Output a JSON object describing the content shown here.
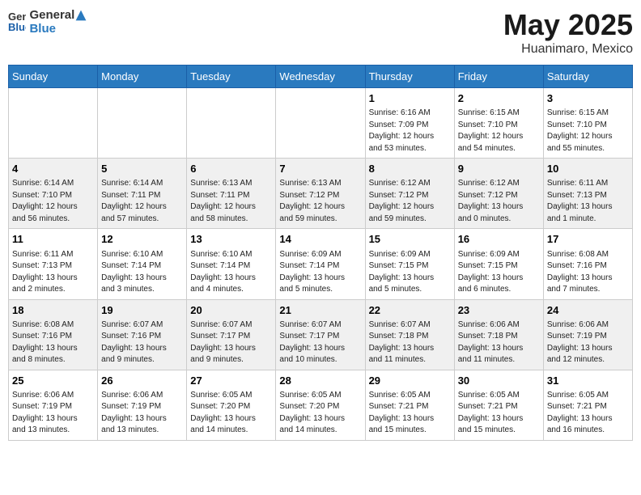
{
  "header": {
    "logo_line1": "General",
    "logo_line2": "Blue",
    "title": "May 2025",
    "subtitle": "Huanimaro, Mexico"
  },
  "days_of_week": [
    "Sunday",
    "Monday",
    "Tuesday",
    "Wednesday",
    "Thursday",
    "Friday",
    "Saturday"
  ],
  "weeks": [
    [
      {
        "day": "",
        "info": ""
      },
      {
        "day": "",
        "info": ""
      },
      {
        "day": "",
        "info": ""
      },
      {
        "day": "",
        "info": ""
      },
      {
        "day": "1",
        "info": "Sunrise: 6:16 AM\nSunset: 7:09 PM\nDaylight: 12 hours\nand 53 minutes."
      },
      {
        "day": "2",
        "info": "Sunrise: 6:15 AM\nSunset: 7:10 PM\nDaylight: 12 hours\nand 54 minutes."
      },
      {
        "day": "3",
        "info": "Sunrise: 6:15 AM\nSunset: 7:10 PM\nDaylight: 12 hours\nand 55 minutes."
      }
    ],
    [
      {
        "day": "4",
        "info": "Sunrise: 6:14 AM\nSunset: 7:10 PM\nDaylight: 12 hours\nand 56 minutes."
      },
      {
        "day": "5",
        "info": "Sunrise: 6:14 AM\nSunset: 7:11 PM\nDaylight: 12 hours\nand 57 minutes."
      },
      {
        "day": "6",
        "info": "Sunrise: 6:13 AM\nSunset: 7:11 PM\nDaylight: 12 hours\nand 58 minutes."
      },
      {
        "day": "7",
        "info": "Sunrise: 6:13 AM\nSunset: 7:12 PM\nDaylight: 12 hours\nand 59 minutes."
      },
      {
        "day": "8",
        "info": "Sunrise: 6:12 AM\nSunset: 7:12 PM\nDaylight: 12 hours\nand 59 minutes."
      },
      {
        "day": "9",
        "info": "Sunrise: 6:12 AM\nSunset: 7:12 PM\nDaylight: 13 hours\nand 0 minutes."
      },
      {
        "day": "10",
        "info": "Sunrise: 6:11 AM\nSunset: 7:13 PM\nDaylight: 13 hours\nand 1 minute."
      }
    ],
    [
      {
        "day": "11",
        "info": "Sunrise: 6:11 AM\nSunset: 7:13 PM\nDaylight: 13 hours\nand 2 minutes."
      },
      {
        "day": "12",
        "info": "Sunrise: 6:10 AM\nSunset: 7:14 PM\nDaylight: 13 hours\nand 3 minutes."
      },
      {
        "day": "13",
        "info": "Sunrise: 6:10 AM\nSunset: 7:14 PM\nDaylight: 13 hours\nand 4 minutes."
      },
      {
        "day": "14",
        "info": "Sunrise: 6:09 AM\nSunset: 7:14 PM\nDaylight: 13 hours\nand 5 minutes."
      },
      {
        "day": "15",
        "info": "Sunrise: 6:09 AM\nSunset: 7:15 PM\nDaylight: 13 hours\nand 5 minutes."
      },
      {
        "day": "16",
        "info": "Sunrise: 6:09 AM\nSunset: 7:15 PM\nDaylight: 13 hours\nand 6 minutes."
      },
      {
        "day": "17",
        "info": "Sunrise: 6:08 AM\nSunset: 7:16 PM\nDaylight: 13 hours\nand 7 minutes."
      }
    ],
    [
      {
        "day": "18",
        "info": "Sunrise: 6:08 AM\nSunset: 7:16 PM\nDaylight: 13 hours\nand 8 minutes."
      },
      {
        "day": "19",
        "info": "Sunrise: 6:07 AM\nSunset: 7:16 PM\nDaylight: 13 hours\nand 9 minutes."
      },
      {
        "day": "20",
        "info": "Sunrise: 6:07 AM\nSunset: 7:17 PM\nDaylight: 13 hours\nand 9 minutes."
      },
      {
        "day": "21",
        "info": "Sunrise: 6:07 AM\nSunset: 7:17 PM\nDaylight: 13 hours\nand 10 minutes."
      },
      {
        "day": "22",
        "info": "Sunrise: 6:07 AM\nSunset: 7:18 PM\nDaylight: 13 hours\nand 11 minutes."
      },
      {
        "day": "23",
        "info": "Sunrise: 6:06 AM\nSunset: 7:18 PM\nDaylight: 13 hours\nand 11 minutes."
      },
      {
        "day": "24",
        "info": "Sunrise: 6:06 AM\nSunset: 7:19 PM\nDaylight: 13 hours\nand 12 minutes."
      }
    ],
    [
      {
        "day": "25",
        "info": "Sunrise: 6:06 AM\nSunset: 7:19 PM\nDaylight: 13 hours\nand 13 minutes."
      },
      {
        "day": "26",
        "info": "Sunrise: 6:06 AM\nSunset: 7:19 PM\nDaylight: 13 hours\nand 13 minutes."
      },
      {
        "day": "27",
        "info": "Sunrise: 6:05 AM\nSunset: 7:20 PM\nDaylight: 13 hours\nand 14 minutes."
      },
      {
        "day": "28",
        "info": "Sunrise: 6:05 AM\nSunset: 7:20 PM\nDaylight: 13 hours\nand 14 minutes."
      },
      {
        "day": "29",
        "info": "Sunrise: 6:05 AM\nSunset: 7:21 PM\nDaylight: 13 hours\nand 15 minutes."
      },
      {
        "day": "30",
        "info": "Sunrise: 6:05 AM\nSunset: 7:21 PM\nDaylight: 13 hours\nand 15 minutes."
      },
      {
        "day": "31",
        "info": "Sunrise: 6:05 AM\nSunset: 7:21 PM\nDaylight: 13 hours\nand 16 minutes."
      }
    ]
  ]
}
